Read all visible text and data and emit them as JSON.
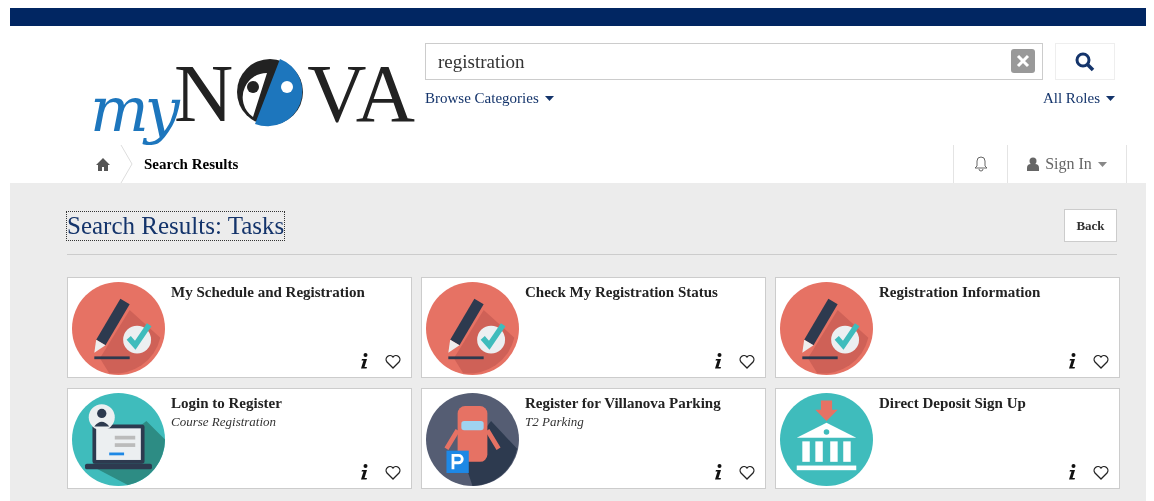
{
  "logo": {
    "script": "my",
    "before": "N",
    "after": "VA"
  },
  "search": {
    "value": "registration"
  },
  "browse": "Browse Categories",
  "roles": "All Roles",
  "breadcrumb": "Search Results",
  "sign_in": "Sign In",
  "title": "Search Results: Tasks",
  "back": "Back",
  "tiles": [
    {
      "kind": "pen-check",
      "title": "My Schedule and Registration"
    },
    {
      "kind": "pen-check",
      "title": "Check My Registration Status"
    },
    {
      "kind": "pen-check",
      "title": "Registration Information"
    },
    {
      "kind": "laptop",
      "title": "Login to Register",
      "subtitle": "Course Registration"
    },
    {
      "kind": "parking",
      "title": "Register for Villanova Parking",
      "subtitle": "T2 Parking"
    },
    {
      "kind": "bank",
      "title": "Direct Deposit Sign Up"
    }
  ]
}
